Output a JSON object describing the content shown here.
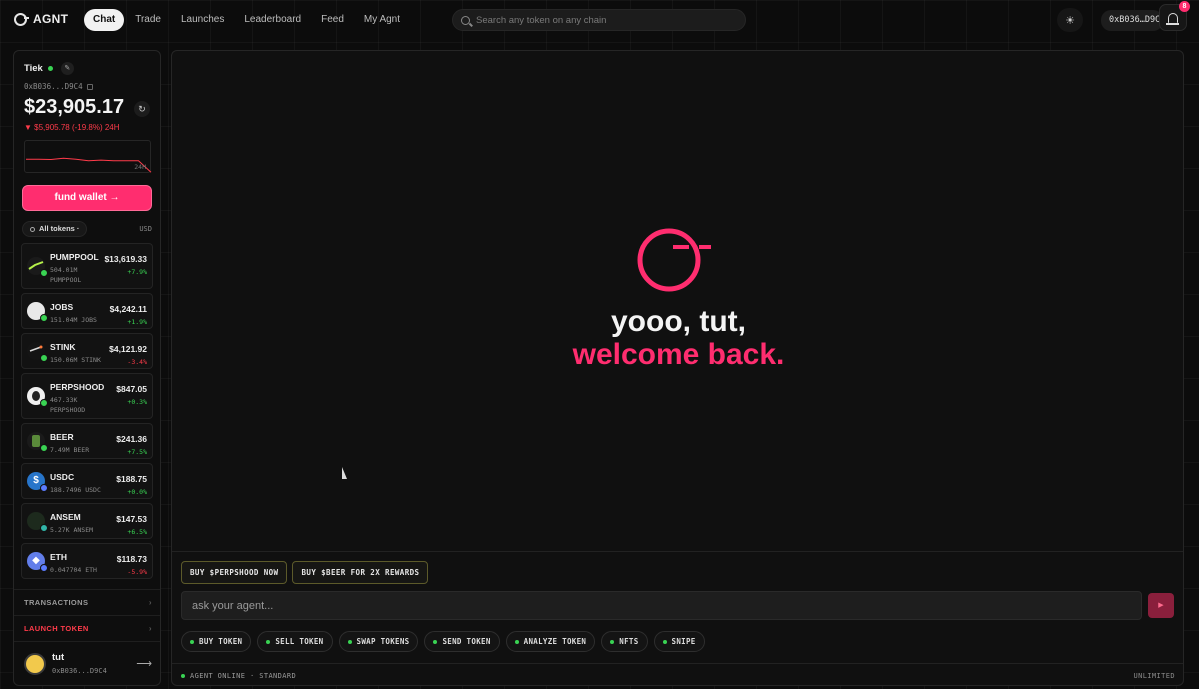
{
  "brand": {
    "name": "AGNT"
  },
  "nav": [
    {
      "label": "Chat",
      "active": true
    },
    {
      "label": "Trade"
    },
    {
      "label": "Launches"
    },
    {
      "label": "Leaderboard"
    },
    {
      "label": "Feed"
    },
    {
      "label": "My Agnt"
    }
  ],
  "search": {
    "placeholder": "Search any token on any chain"
  },
  "header": {
    "wallet": "0xB036…D9C4",
    "notifications": "8"
  },
  "account": {
    "name": "Tiek",
    "address": "0xB036...D9C4",
    "balance": "$23,905.17",
    "change": "▼ $5,905.78 (-19.8%) 24H",
    "spark_label": "24H",
    "spark_trend": [
      0.55,
      0.55,
      0.56,
      0.52,
      0.55,
      0.6,
      0.58,
      0.6,
      0.6,
      0.6,
      0.95
    ]
  },
  "fund_button": "fund wallet →",
  "filter": {
    "label": "All tokens ·",
    "currency": "USD"
  },
  "tokens": [
    {
      "symbol": "PUMPPOOL",
      "amount": "504.01M",
      "sub2": "PUMPPOOL",
      "value": "$13,619.33",
      "change": "+7.9%",
      "dir": "up"
    },
    {
      "symbol": "JOBS",
      "amount": "151.04M JOBS",
      "value": "$4,242.11",
      "change": "+1.9%",
      "dir": "up"
    },
    {
      "symbol": "STINK",
      "amount": "150.06M STINK",
      "value": "$4,121.92",
      "change": "-3.4%",
      "dir": "down"
    },
    {
      "symbol": "PERPSHOOD",
      "amount": "467.33K",
      "sub2": "PERPSHOOD",
      "value": "$847.05",
      "change": "+0.3%",
      "dir": "up"
    },
    {
      "symbol": "BEER",
      "amount": "7.49M BEER",
      "value": "$241.36",
      "change": "+7.5%",
      "dir": "up"
    },
    {
      "symbol": "USDC",
      "amount": "188.7496 USDC",
      "value": "$188.75",
      "change": "+0.0%",
      "dir": "up"
    },
    {
      "symbol": "ANSEM",
      "amount": "5.27K ANSEM",
      "value": "$147.53",
      "change": "+6.5%",
      "dir": "up"
    },
    {
      "symbol": "ETH",
      "amount": "0.047704 ETH",
      "value": "$118.73",
      "change": "-5.9%",
      "dir": "down"
    }
  ],
  "sidebar_links": {
    "transactions": "TRANSACTIONS",
    "launch": "LAUNCH TOKEN"
  },
  "user": {
    "name": "tut",
    "address": "0xB036...D9C4"
  },
  "hero": {
    "line1": "yooo, tut,",
    "line2": "welcome back."
  },
  "quick_actions": [
    "BUY $PERPSHOOD NOW",
    "BUY $BEER FOR 2X REWARDS"
  ],
  "composer": {
    "placeholder": "ask your agent..."
  },
  "actions": [
    "BUY TOKEN",
    "SELL TOKEN",
    "SWAP TOKENS",
    "SEND TOKEN",
    "ANALYZE TOKEN",
    "NFTS",
    "SNIPE"
  ],
  "status": {
    "left": "AGENT ONLINE · STANDARD",
    "right": "UNLIMITED"
  },
  "colors": {
    "accent": "#ff2d6f",
    "up": "#39d353",
    "down": "#ff3b4a"
  }
}
